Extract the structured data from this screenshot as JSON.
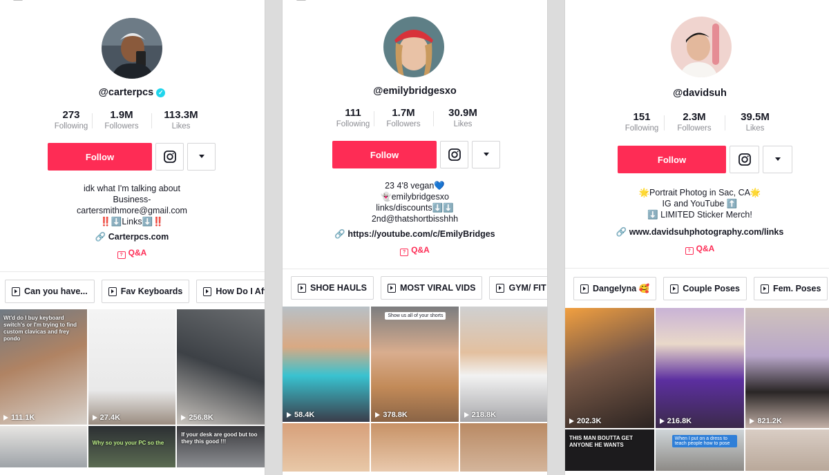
{
  "profiles": [
    {
      "username": "@carterpcs",
      "verified": true,
      "stats": [
        {
          "num": "273",
          "label": "Following"
        },
        {
          "num": "1.9M",
          "label": "Followers"
        },
        {
          "num": "113.3M",
          "label": "Likes"
        }
      ],
      "follow_label": "Follow",
      "bio": [
        "idk what I'm talking about",
        "Business-",
        "cartersmithmore@gmail.com",
        "‼️⬇️Links⬇️‼️"
      ],
      "link": "Carterpcs.com",
      "qa": "Q&A",
      "playlists": [
        "Can you have...",
        "Fav Keyboards",
        "How Do I Affo"
      ],
      "videos": [
        {
          "views": "111.1K",
          "caption": "Wt'd do I buy keyboard switch's or I'm trying to find custom clavicas and frey pondo"
        },
        {
          "views": "27.4K",
          "caption": ""
        },
        {
          "views": "256.8K",
          "caption": ""
        },
        {
          "views": "",
          "caption": ""
        },
        {
          "views": "",
          "caption": "Why so you your PC so the"
        },
        {
          "views": "",
          "caption": "If your desk are good but too they this good !!!"
        }
      ]
    },
    {
      "username": "@emilybridgesxo",
      "verified": false,
      "stats": [
        {
          "num": "111",
          "label": "Following"
        },
        {
          "num": "1.7M",
          "label": "Followers"
        },
        {
          "num": "30.9M",
          "label": "Likes"
        }
      ],
      "follow_label": "Follow",
      "bio": [
        "23 4'8 vegan💙",
        "👻emilybridgesxo",
        "links/discounts⬇️⬇️",
        "2nd@thatshortbisshhh"
      ],
      "link": "https://youtube.com/c/EmilyBridges",
      "qa": "Q&A",
      "playlists": [
        "SHOE HAULS",
        "MOST VIRAL VIDS",
        "GYM/ FIT TI"
      ],
      "videos": [
        {
          "views": "58.4K",
          "caption": ""
        },
        {
          "views": "378.8K",
          "caption": "Show us all of your shorts"
        },
        {
          "views": "218.8K",
          "caption": ""
        },
        {
          "views": "",
          "caption": ""
        },
        {
          "views": "",
          "caption": ""
        },
        {
          "views": "",
          "caption": ""
        }
      ]
    },
    {
      "username": "@davidsuh",
      "verified": false,
      "stats": [
        {
          "num": "151",
          "label": "Following"
        },
        {
          "num": "2.3M",
          "label": "Followers"
        },
        {
          "num": "39.5M",
          "label": "Likes"
        }
      ],
      "follow_label": "Follow",
      "bio": [
        "🌟Portrait Photog in Sac, CA🌟",
        "IG and YouTube ⬆️",
        "⬇️ LIMITED Sticker Merch!"
      ],
      "link": "www.davidsuhphotography.com/links",
      "qa": "Q&A",
      "playlists": [
        "Dangelyna 🥰",
        "Couple Poses",
        "Fem. Poses"
      ],
      "videos": [
        {
          "views": "202.3K",
          "caption": ""
        },
        {
          "views": "216.8K",
          "caption": ""
        },
        {
          "views": "821.2K",
          "caption": ""
        },
        {
          "views": "",
          "caption": "THIS MAN BOUTTA GET ANYONE HE WANTS"
        },
        {
          "views": "",
          "caption": "When I put on a dress to teach people how to pose"
        },
        {
          "views": "",
          "caption": ""
        }
      ]
    }
  ],
  "colors": {
    "accent": "#fe2c55",
    "verified": "#20d5ec",
    "text": "#161823",
    "muted": "#8a8b91"
  }
}
